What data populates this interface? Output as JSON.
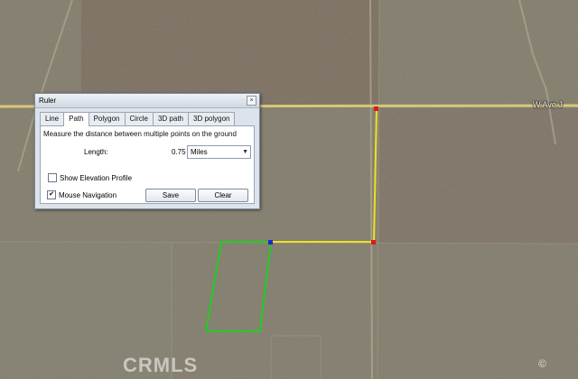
{
  "map": {
    "road_labels": [
      {
        "text": "W Ave J"
      }
    ],
    "watermark": "CRMLS",
    "path_color": "#f0e020",
    "polygon_color": "#22cc22",
    "road_color": "#d8c878",
    "terrain_color": "#7d7868"
  },
  "ruler": {
    "title": "Ruler",
    "close_glyph": "×",
    "tabs": [
      "Line",
      "Path",
      "Polygon",
      "Circle",
      "3D path",
      "3D polygon"
    ],
    "active_tab": "Path",
    "description": "Measure the distance between multiple points on the ground",
    "length_label": "Length:",
    "length_value": "0.75",
    "unit": "Miles",
    "show_elevation_label": "Show Elevation Profile",
    "show_elevation_checked": false,
    "mouse_nav_label": "Mouse Navigation",
    "mouse_nav_checked": true,
    "save_label": "Save",
    "clear_label": "Clear"
  }
}
